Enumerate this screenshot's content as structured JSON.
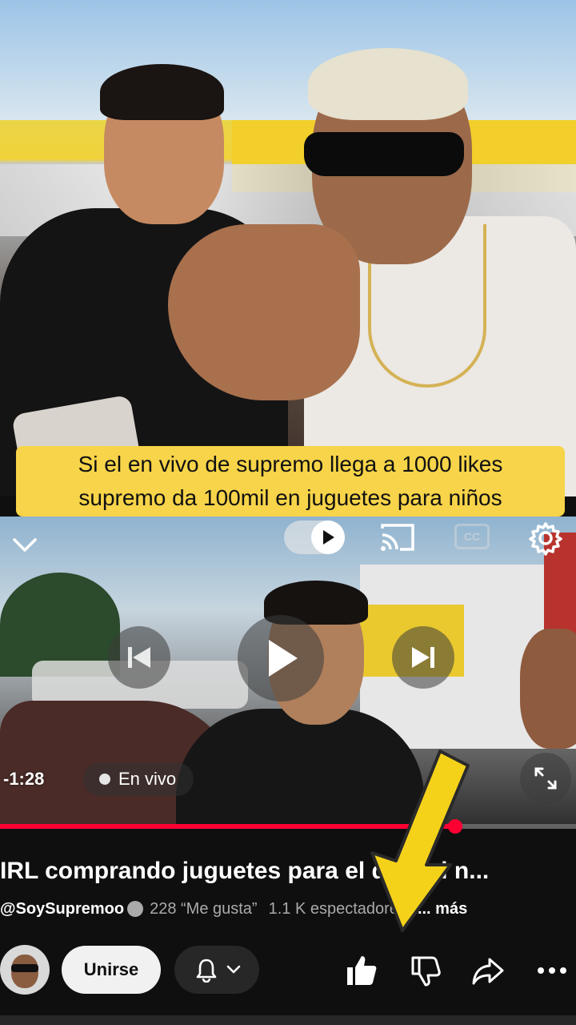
{
  "caption": {
    "line1": "Si el en vivo de supremo llega a 1000 likes",
    "line2": "supremo da 100mil en juguetes para niños"
  },
  "player": {
    "time": "-1:28",
    "live_label": "En vivo",
    "progress": 0.79,
    "cc_label": "CC"
  },
  "video": {
    "title": "IRL comprando juguetes para el día del n...",
    "channel": "@SoySupremoo",
    "likes": "228 “Me gusta”",
    "viewers": "1.1 K espectadores",
    "more": "... más"
  },
  "actions": {
    "join_label": "Unirse"
  },
  "colors": {
    "caption_bg": "#f7d449",
    "progress": "#ff0033",
    "arrow": "#f5d21a"
  }
}
